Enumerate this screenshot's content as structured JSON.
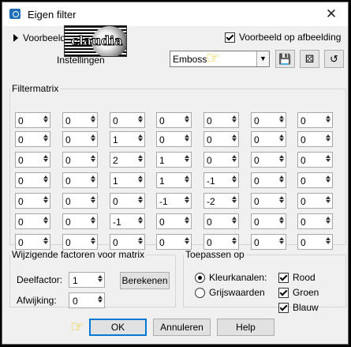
{
  "window": {
    "title": "Eigen filter",
    "close_glyph": "✕"
  },
  "preview": {
    "toggle_label": "Voorbeeld",
    "settings_label": "Instellingen",
    "logo_text": "claudia",
    "checkbox_label": "Voorbeeld op afbeelding",
    "checked": true
  },
  "preset": {
    "value": "Emboss",
    "dropdown_icon": "chevron-down-icon"
  },
  "toolbar": {
    "save_icon": "save-icon",
    "random_icon": "dice-icon",
    "reset_icon": "reset-icon"
  },
  "matrix": {
    "label": "Filtermatrix",
    "rows": [
      [
        "0",
        "0",
        "0",
        "0",
        "0",
        "0",
        "0"
      ],
      [
        "0",
        "0",
        "1",
        "0",
        "0",
        "0",
        "0"
      ],
      [
        "0",
        "0",
        "2",
        "1",
        "0",
        "0",
        "0"
      ],
      [
        "0",
        "0",
        "1",
        "1",
        "-1",
        "0",
        "0"
      ],
      [
        "0",
        "0",
        "0",
        "-1",
        "-2",
        "0",
        "0"
      ],
      [
        "0",
        "0",
        "-1",
        "0",
        "0",
        "0",
        "0"
      ],
      [
        "0",
        "0",
        "0",
        "0",
        "0",
        "0",
        "0"
      ]
    ]
  },
  "factors": {
    "label": "Wijzigende factoren voor matrix",
    "divisor_label": "Deelfactor:",
    "divisor_value": "1",
    "compute_label": "Berekenen",
    "bias_label": "Afwijking:",
    "bias_value": "0"
  },
  "apply": {
    "label": "Toepassen op",
    "radio_color": "Kleurkanalen:",
    "radio_gray": "Grijswaarden",
    "selected": "Kleurkanalen:",
    "channels": [
      {
        "label": "Rood",
        "checked": true
      },
      {
        "label": "Groen",
        "checked": true
      },
      {
        "label": "Blauw",
        "checked": true
      }
    ]
  },
  "buttons": {
    "ok": "OK",
    "cancel": "Annuleren",
    "help": "Help"
  },
  "colors": {
    "pointer": "#f2c200",
    "default_button_border": "#0078d7"
  }
}
